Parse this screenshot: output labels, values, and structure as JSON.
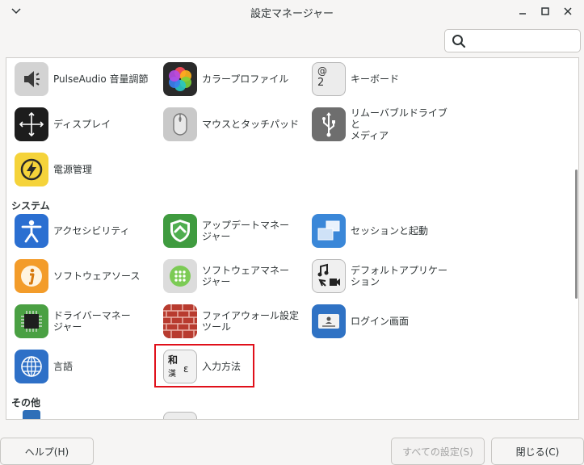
{
  "window": {
    "title": "設定マネージャー"
  },
  "search": {
    "value": "",
    "placeholder": ""
  },
  "sections": {
    "system": "システム",
    "other": "その他"
  },
  "items": {
    "pulseaudio": "PulseAudio 音量調節",
    "color_profile": "カラープロファイル",
    "keyboard": "キーボード",
    "display": "ディスプレイ",
    "mouse": "マウスとタッチパッド",
    "removable_line1": "リムーバブルドライブと",
    "removable_line2": "メディア",
    "power": "電源管理",
    "accessibility": "アクセシビリティ",
    "update_line1": "アップデートマネー",
    "update_line2": "ジャー",
    "session": "セッションと起動",
    "software_sources": "ソフトウェアソース",
    "software_manager_line1": "ソフトウェアマネー",
    "software_manager_line2": "ジャー",
    "default_apps_line1": "デフォルトアプリケー",
    "default_apps_line2": "ション",
    "driver_line1": "ドライバーマネー",
    "driver_line2": "ジャー",
    "firewall_line1": "ファイアウォール設定",
    "firewall_line2": "ツール",
    "login": "ログイン画面",
    "language": "言語",
    "input_method": "入力方法"
  },
  "keyboard_icon": {
    "top": "@",
    "bottom": "2"
  },
  "input_icon": {
    "kanji": "和",
    "hangul": "漢",
    "greek": "ε"
  },
  "buttons": {
    "help": "ヘルプ(H)",
    "all_settings": "すべての設定(S)",
    "close": "閉じる(C)"
  },
  "colors": {
    "highlight": "#e0101a",
    "accent": "#3584e4"
  }
}
